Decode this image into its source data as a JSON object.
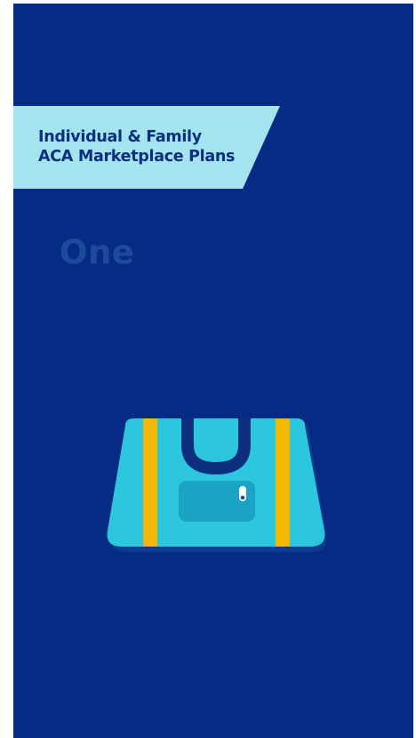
{
  "banner": {
    "line1": "Individual & Family",
    "line2": "ACA Marketplace Plans"
  },
  "step": {
    "label": "One"
  },
  "illustration": {
    "icon": "duffel-bag-icon"
  },
  "colors": {
    "background": "#062b84",
    "banner": "#a3e4ef",
    "bag": "#2cc6de",
    "straps": "#f4b800"
  }
}
